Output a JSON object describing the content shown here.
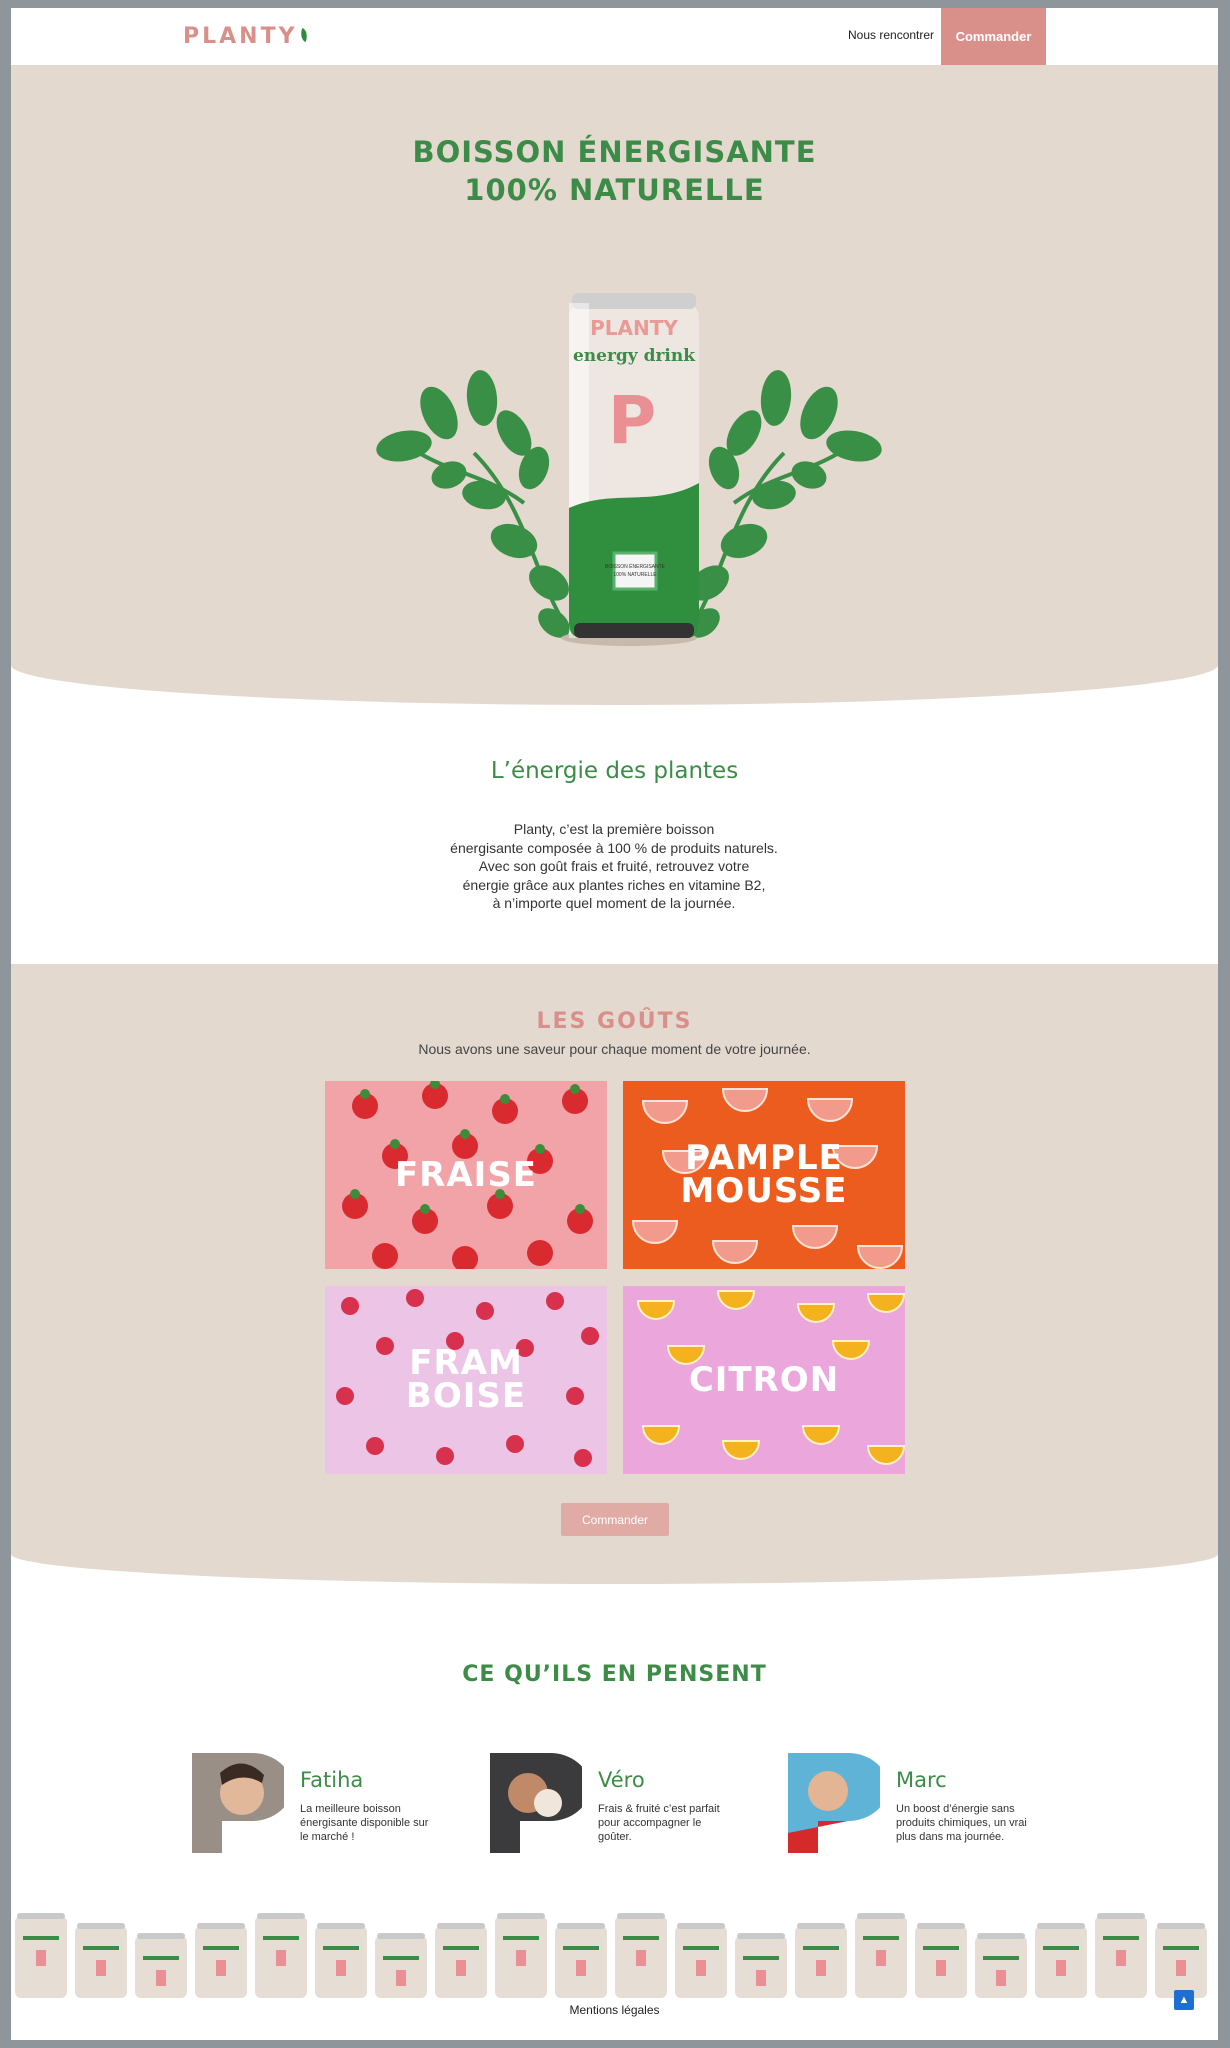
{
  "header": {
    "logo": "PLANTY",
    "nav_link": "Nous rencontrer",
    "order_button": "Commander"
  },
  "hero": {
    "title_line1": "BOISSON ÉNERGISANTE",
    "title_line2": "100% NATURELLE",
    "can_brand": "PLANTY",
    "can_subtitle": "energy drink",
    "can_letter": "P",
    "can_label_line1": "BOISSON ÉNERGISANTE",
    "can_label_line2": "100% NATURELLE"
  },
  "energie": {
    "title": "L’énergie des plantes",
    "text": "Planty, c’est la première boisson\nénergisante composée à 100 % de produits naturels.\nAvec son goût frais et fruité, retrouvez votre\nénergie grâce aux plantes riches en vitamine B2,\nà n’importe quel moment de la journée."
  },
  "flavors": {
    "title": "LES GOÛTS",
    "subtitle": "Nous avons une saveur pour chaque moment de votre journée.",
    "items": [
      {
        "label": "FRAISE",
        "bg": "#f2a3a8"
      },
      {
        "label": "PAMPLE\nMOUSSE",
        "bg": "#ec5c1e"
      },
      {
        "label": "FRAM\nBOISE",
        "bg": "#ecc5e6"
      },
      {
        "label": "CITRON",
        "bg": "#eba6dc"
      }
    ],
    "order_button": "Commander"
  },
  "testimonials": {
    "title": "CE QU’ILS EN PENSENT",
    "items": [
      {
        "name": "Fatiha",
        "text": "La meilleure boisson\nénergisante disponible sur\nle marché !"
      },
      {
        "name": "Véro",
        "text": "Frais & fruité c’est parfait\npour accompagner le\ngoûter."
      },
      {
        "name": "Marc",
        "text": "Un boost d’énergie sans\nproduits chimiques, un vrai\nplus dans ma journée."
      }
    ]
  },
  "footer": {
    "legal_link": "Mentions légales",
    "scroll_top_icon": "chevron-up-icon"
  },
  "colors": {
    "brand_pink": "#d9908a",
    "brand_green": "#3c8c47",
    "beige": "#e4d9cf"
  }
}
